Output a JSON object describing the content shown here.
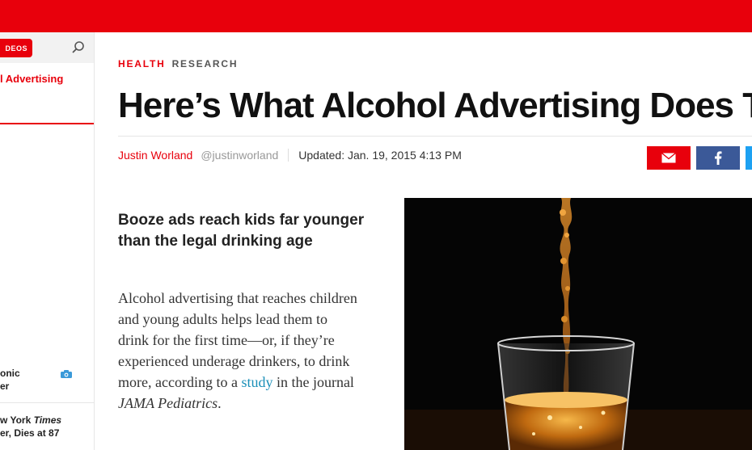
{
  "colors": {
    "brand_red": "#e8000c",
    "facebook_blue": "#3b5998",
    "twitter_blue": "#1da1f2",
    "link_blue": "#1a8fb8"
  },
  "sidebar": {
    "videos_label": "DEOS",
    "link_label": "l Advertising",
    "item1_line1": "onic",
    "item1_line2": "er",
    "item2_line1_pre": "w York ",
    "item2_line1_italic": "Times",
    "item2_line2": "er, Dies at 87"
  },
  "article": {
    "section_primary": "HEALTH",
    "section_secondary": "RESEARCH",
    "headline": "Here’s What Alcohol Advertising Does T",
    "author": "Justin Worland",
    "handle": "@justinworland",
    "updated": "Updated: Jan. 19, 2015 4:13 PM",
    "dek": "Booze ads reach kids far younger than the legal drinking age",
    "body_before_link": "Alcohol advertising that reaches children and young adults helps lead them to drink for the first time—or, if they’re experienced underage drinkers, to drink more, according to a ",
    "body_link": "study",
    "body_after_link": " in the journal ",
    "body_journal": "JAMA Pediatrics",
    "body_end": "."
  },
  "icons": {
    "search": "search-icon",
    "camera": "camera-icon",
    "email": "email-icon",
    "facebook": "facebook-icon",
    "twitter": "twitter-icon"
  }
}
